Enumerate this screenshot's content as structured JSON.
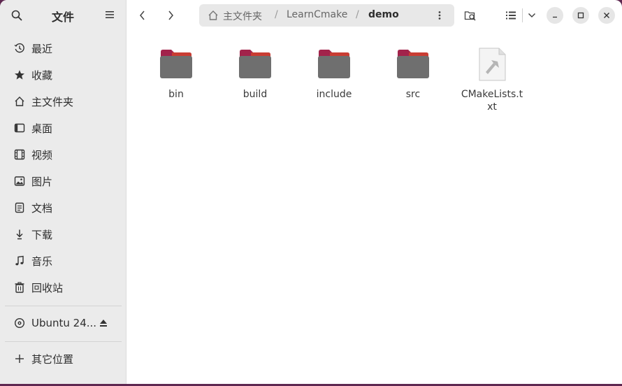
{
  "sidebar": {
    "title": "文件",
    "places": [
      {
        "label": "最近",
        "icon": "clock-icon"
      },
      {
        "label": "收藏",
        "icon": "star-icon"
      },
      {
        "label": "主文件夹",
        "icon": "home-icon"
      },
      {
        "label": "桌面",
        "icon": "desktop-icon"
      },
      {
        "label": "视频",
        "icon": "film-icon"
      },
      {
        "label": "图片",
        "icon": "image-icon"
      },
      {
        "label": "文档",
        "icon": "document-icon"
      },
      {
        "label": "下载",
        "icon": "download-icon"
      },
      {
        "label": "音乐",
        "icon": "music-icon"
      },
      {
        "label": "回收站",
        "icon": "trash-icon"
      }
    ],
    "devices": [
      {
        "label": "Ubuntu 24...",
        "icon": "disc-icon"
      }
    ],
    "other": {
      "label": "其它位置",
      "icon": "plus-icon"
    }
  },
  "toolbar": {
    "breadcrumbs": [
      "主文件夹",
      "LearnCmake",
      "demo"
    ]
  },
  "files": [
    {
      "name": "bin",
      "type": "folder"
    },
    {
      "name": "build",
      "type": "folder"
    },
    {
      "name": "include",
      "type": "folder"
    },
    {
      "name": "src",
      "type": "folder"
    },
    {
      "name": "CMakeLists.txt",
      "type": "text"
    }
  ],
  "colors": {
    "accent": "#e95420",
    "folder_tab": "#a2234b",
    "folder_body": "#6f6f6f",
    "desktop_bg": "#5e2750"
  }
}
